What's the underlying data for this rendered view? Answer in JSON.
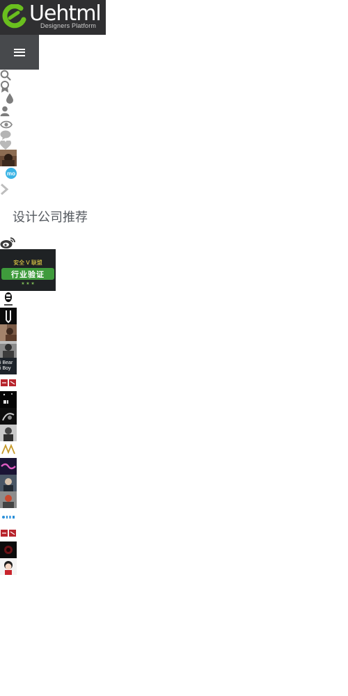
{
  "header": {
    "logo_text": "Uehtml",
    "tagline": "Designers Platform",
    "menu_icon": "hamburger-icon"
  },
  "toolbar_icons": [
    "search-icon",
    "award-icon",
    "drop-icon",
    "user-icon",
    "eye-icon",
    "comment-icon",
    "heart-icon"
  ],
  "avatar_badge": "mo",
  "chevron_icon": "chevron-right-icon",
  "recommend": {
    "title": "设计公司推荐",
    "weibo_icon": "weibo-icon",
    "badge": {
      "top_text": "安全 V 联盟",
      "main_text": "行业验证",
      "stars": "★ ★ ★"
    }
  },
  "companies": [
    {
      "name": "company-logo-1"
    },
    {
      "name": "company-logo-2"
    },
    {
      "name": "company-logo-3"
    },
    {
      "name": "company-logo-4"
    },
    {
      "name": "company-logo-5",
      "label_line1": "i Bear",
      "label_line2": "i Boy"
    },
    {
      "name": "company-logo-6"
    },
    {
      "name": "company-logo-7"
    },
    {
      "name": "company-logo-8"
    },
    {
      "name": "company-logo-9"
    },
    {
      "name": "company-logo-10"
    },
    {
      "name": "company-logo-11"
    },
    {
      "name": "company-logo-12"
    },
    {
      "name": "company-logo-13"
    },
    {
      "name": "company-logo-14"
    },
    {
      "name": "company-logo-15"
    },
    {
      "name": "company-logo-16"
    },
    {
      "name": "company-logo-17"
    },
    {
      "name": "company-logo-18"
    }
  ],
  "colors": {
    "header_bg": "#2f2f31",
    "menu_bg": "#47494c",
    "brand_green": "#6abf1e",
    "badge_green": "#3f9b3c",
    "icon_gray": "#8a8a8a",
    "mo_blue": "#3bb4e5"
  }
}
